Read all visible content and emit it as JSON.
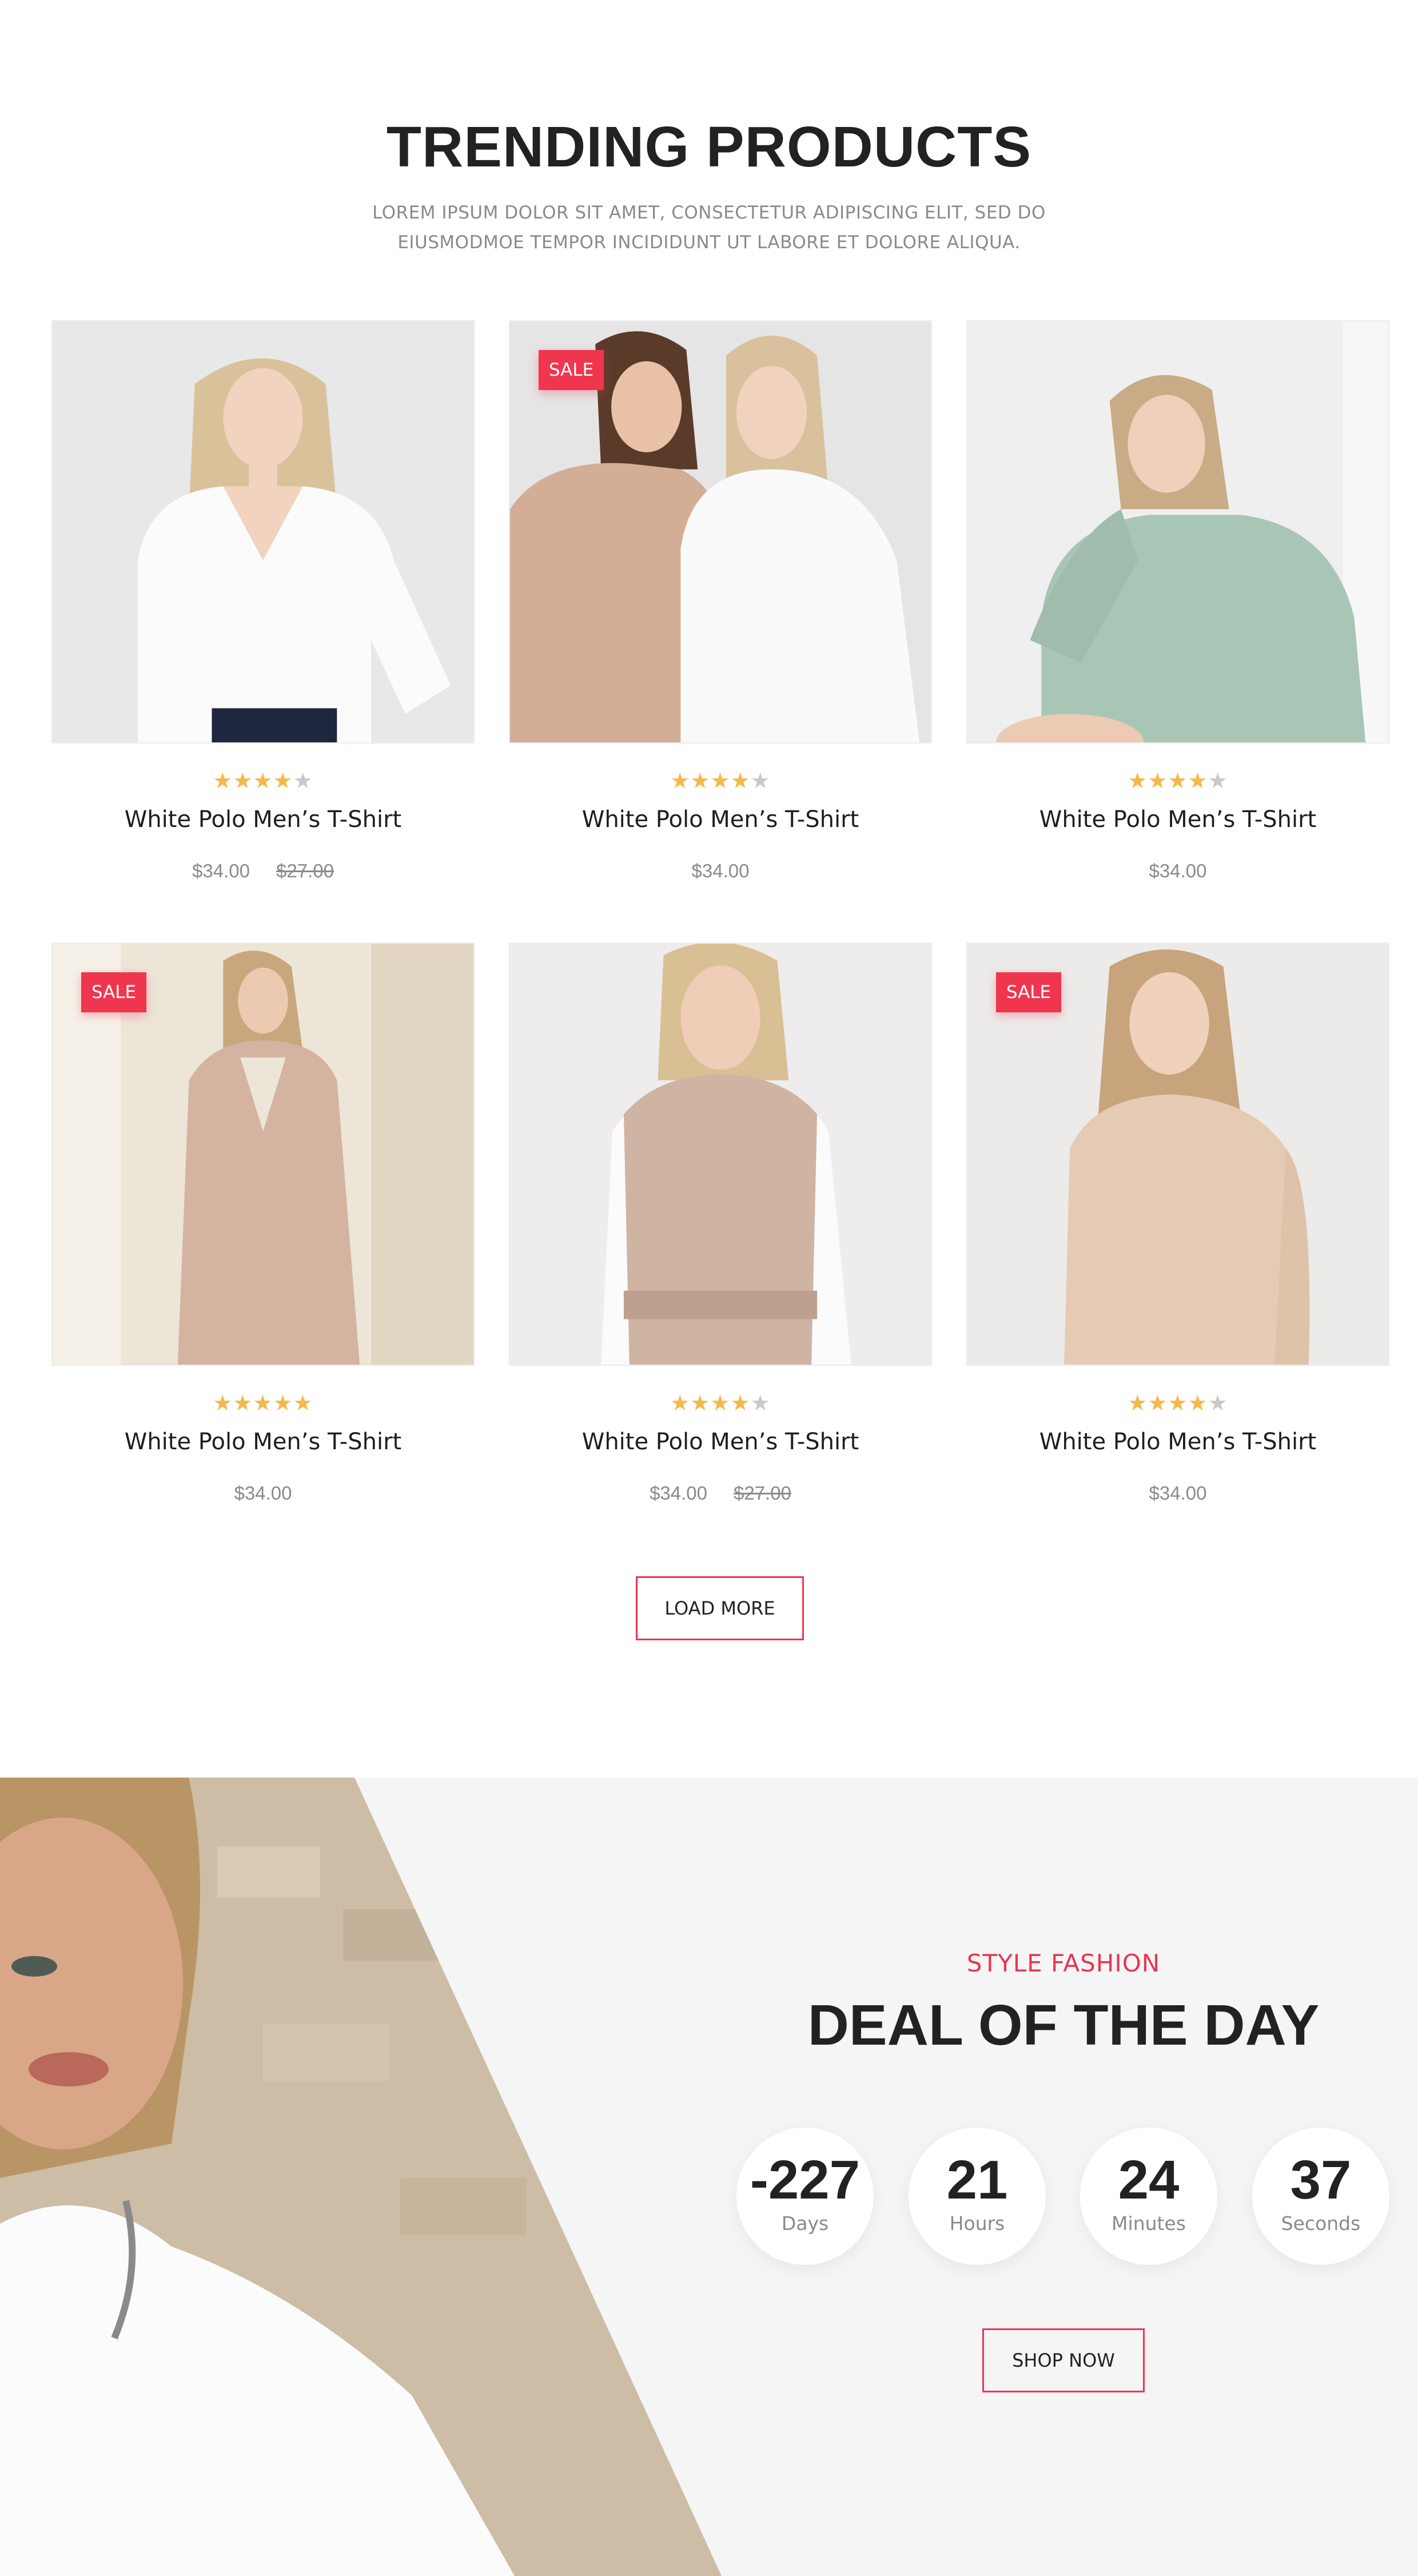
{
  "trending": {
    "title": "TRENDING PRODUCTS",
    "subtitle": "LOREM IPSUM DOLOR SIT AMET, CONSECTETUR ADIPISCING ELIT, SED DO EIUSMODMOE TEMPOR INCIDIDUNT UT LABORE ET DOLORE ALIQUA.",
    "load_more_label": "LOAD MORE"
  },
  "products": [
    {
      "name": "White Polo Men’s T-Shirt",
      "price": "$34.00",
      "old_price": "$27.00",
      "sale": "",
      "rating": 4,
      "image": "woman-white-blouse"
    },
    {
      "name": "White Polo Men’s T-Shirt",
      "price": "$34.00",
      "old_price": "",
      "sale": "SALE",
      "rating": 4,
      "image": "two-women-hoodies"
    },
    {
      "name": "White Polo Men’s T-Shirt",
      "price": "$34.00",
      "old_price": "",
      "sale": "",
      "rating": 4,
      "image": "woman-mint-hoodie"
    },
    {
      "name": "White Polo Men’s T-Shirt",
      "price": "$34.00",
      "old_price": "",
      "sale": "SALE",
      "rating": 5,
      "image": "woman-beige-coat"
    },
    {
      "name": "White Polo Men’s T-Shirt",
      "price": "$34.00",
      "old_price": "$27.00",
      "sale": "",
      "rating": 4,
      "image": "woman-leather-vest"
    },
    {
      "name": "White Polo Men’s T-Shirt",
      "price": "$34.00",
      "old_price": "",
      "sale": "SALE",
      "rating": 4,
      "image": "woman-beige-dress"
    }
  ],
  "deal": {
    "kicker": "STYLE FASHION",
    "title": "DEAL OF THE DAY",
    "countdown": [
      {
        "value": "-227",
        "unit": "Days"
      },
      {
        "value": "21",
        "unit": "Hours"
      },
      {
        "value": "24",
        "unit": "Minutes"
      },
      {
        "value": "37",
        "unit": "Seconds"
      }
    ],
    "shop_now_label": "SHOP NOW",
    "image": "woman-white-top-closeup"
  },
  "colors": {
    "accent": "#f0354f",
    "star": "#f5b84a",
    "star_off": "#c9c9c9",
    "text": "#222222",
    "muted": "#8a8a8a",
    "deal_bg": "#f5f5f5"
  }
}
